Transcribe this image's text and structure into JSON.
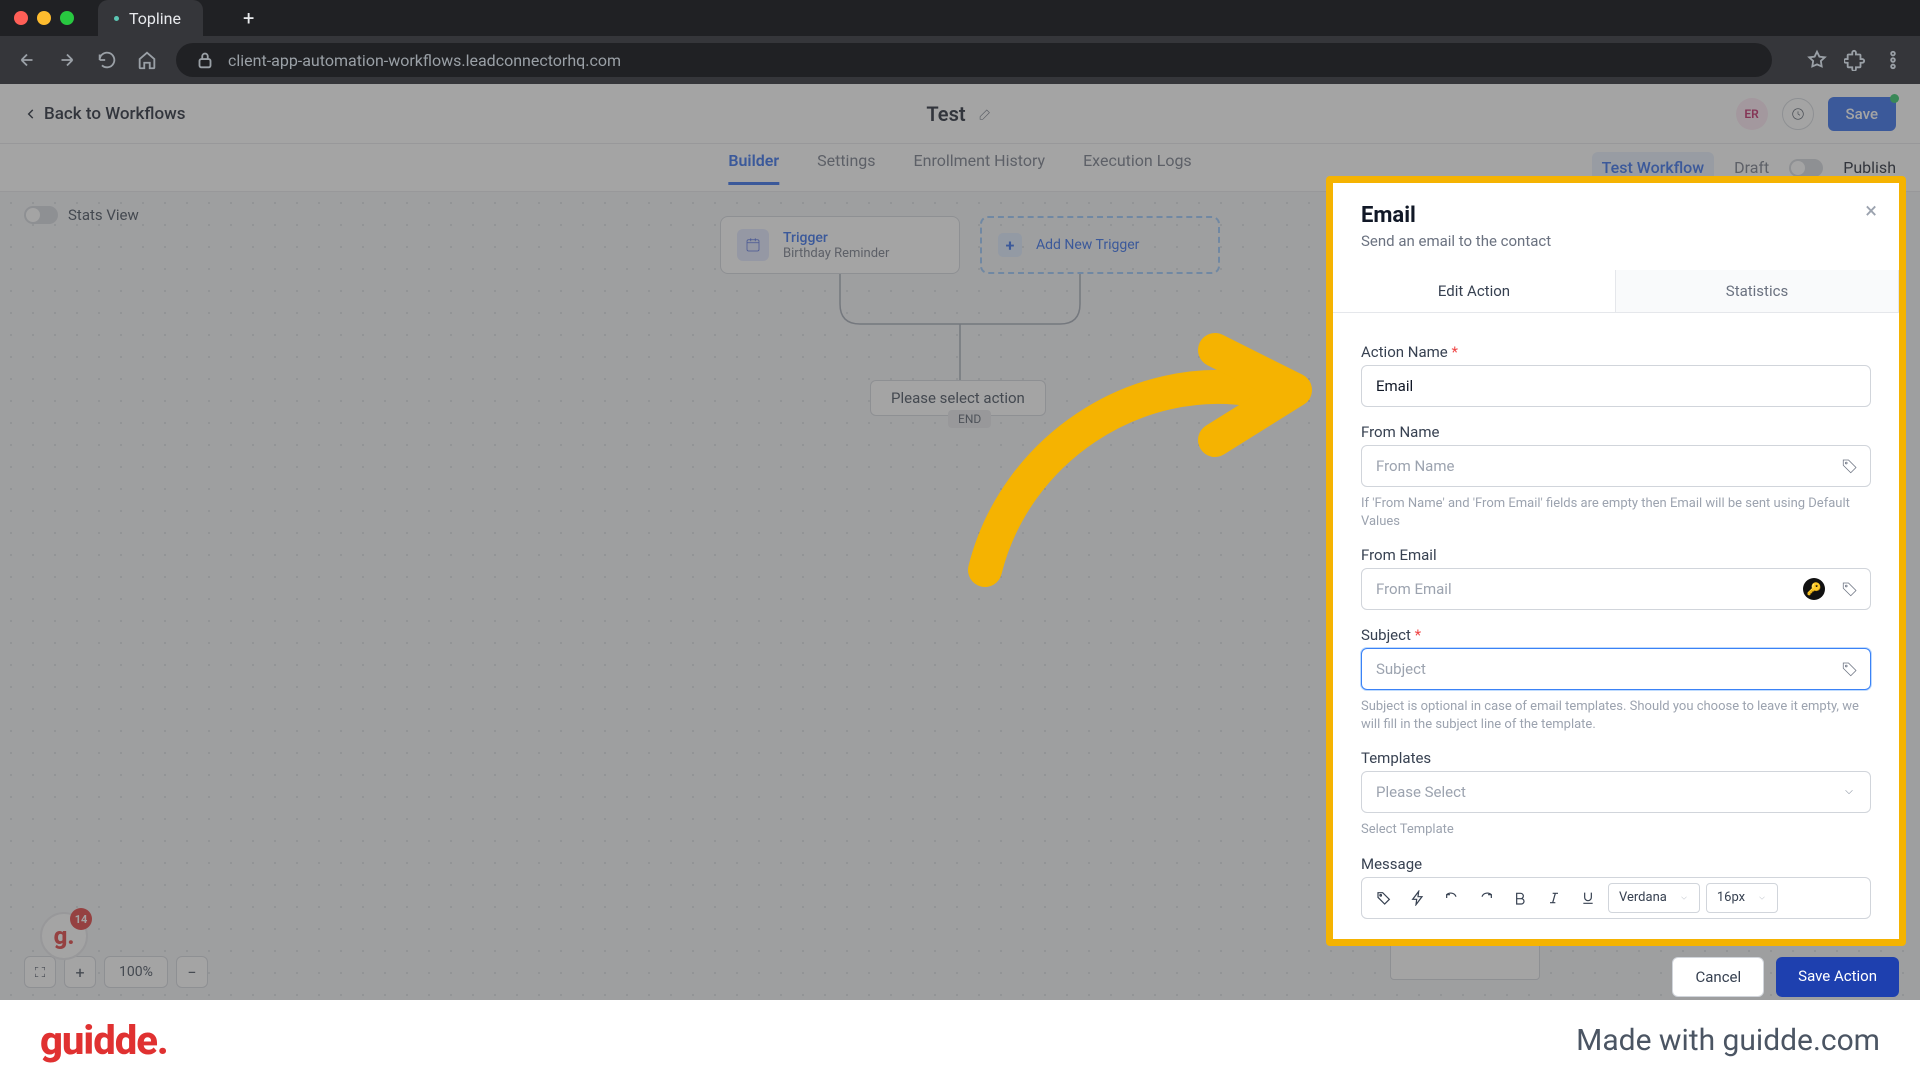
{
  "browser": {
    "tab_title": "Topline",
    "url": "client-app-automation-workflows.leadconnectorhq.com"
  },
  "header": {
    "back_label": "Back to Workflows",
    "title": "Test",
    "avatar": "ER",
    "save_label": "Save"
  },
  "subheader": {
    "tabs": [
      "Builder",
      "Settings",
      "Enrollment History",
      "Execution Logs"
    ],
    "active_index": 0,
    "test_workflow": "Test Workflow",
    "draft": "Draft",
    "publish": "Publish"
  },
  "canvas": {
    "stats_view": "Stats View",
    "trigger_label": "Trigger",
    "trigger_name": "Birthday Reminder",
    "add_trigger": "Add New Trigger",
    "select_action": "Please select action",
    "end": "END",
    "zoom": "100%"
  },
  "panel": {
    "title": "Email",
    "subtitle": "Send an email to the contact",
    "tab_edit": "Edit Action",
    "tab_stats": "Statistics",
    "action_name_label": "Action Name",
    "action_name_value": "Email",
    "from_name_label": "From Name",
    "from_name_placeholder": "From Name",
    "from_name_hint": "If 'From Name' and 'From Email' fields are empty then Email will be sent using Default Values",
    "from_email_label": "From Email",
    "from_email_placeholder": "From Email",
    "subject_label": "Subject",
    "subject_placeholder": "Subject",
    "subject_hint": "Subject is optional in case of email templates. Should you choose to leave it empty, we will fill in the subject line of the template.",
    "templates_label": "Templates",
    "templates_placeholder": "Please Select",
    "templates_hint": "Select Template",
    "message_label": "Message",
    "editor_font": "Verdana",
    "editor_size": "16px",
    "cancel": "Cancel",
    "save_action": "Save Action"
  },
  "guidde": {
    "badge_count": "14",
    "logo": "guidde.",
    "made": "Made with guidde.com"
  }
}
